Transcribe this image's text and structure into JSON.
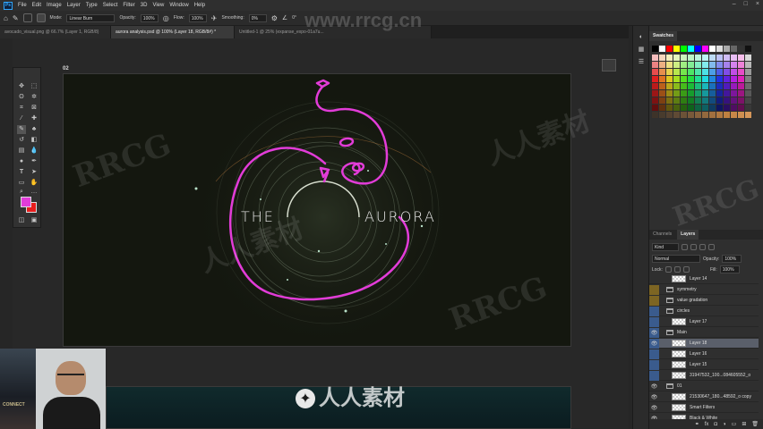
{
  "menu": {
    "app_logo": "Ps",
    "items": [
      "File",
      "Edit",
      "Image",
      "Layer",
      "Type",
      "Select",
      "Filter",
      "3D",
      "View",
      "Window",
      "Help"
    ]
  },
  "options_bar": {
    "mode_label": "Mode:",
    "mode_value": "Linear Burn",
    "opacity_label": "Opacity:",
    "opacity_value": "100%",
    "flow_label": "Flow:",
    "flow_value": "100%",
    "smoothing_label": "Smoothing:",
    "smoothing_value": "0%",
    "angle_value": "0°"
  },
  "tabs": [
    {
      "label": "avocado_visual.png @ 66.7% (Layer 1, RGB/8)",
      "active": false
    },
    {
      "label": "aurora analysis.psd @ 100% (Layer 18, RGB/8#) *",
      "active": true
    },
    {
      "label": "Untitled-1 @ 25% (expanse_expo-01a7u...",
      "active": false
    }
  ],
  "canvas": {
    "artboard_label": "02",
    "title_left": "THE",
    "title_right": "AURORA"
  },
  "webcam": {
    "poster_text": "CONNECT"
  },
  "panels": {
    "swatches_tab": "Swatches",
    "channels_tab": "Channels",
    "layers_tab": "Layers",
    "filter_kind": "Kind",
    "blend_mode": "Normal",
    "opacity_label": "Opacity:",
    "opacity_value": "100%",
    "lock_label": "Lock:",
    "fill_label": "Fill:",
    "fill_value": "100%"
  },
  "layers": [
    {
      "name": "Layer 14",
      "kind": "layer",
      "eye": "",
      "selected": false
    },
    {
      "name": "symmetry",
      "kind": "folder",
      "eye": "yellow",
      "selected": false
    },
    {
      "name": "value gradation",
      "kind": "folder",
      "eye": "yellow",
      "selected": false
    },
    {
      "name": "circles",
      "kind": "folder",
      "eye": "blue",
      "selected": false
    },
    {
      "name": "Layer 17",
      "kind": "layer",
      "eye": "blue",
      "selected": false
    },
    {
      "name": "Main",
      "kind": "folder",
      "eye": "blue-visible",
      "selected": false
    },
    {
      "name": "Layer 18",
      "kind": "layer",
      "eye": "blue-visible",
      "selected": true
    },
    {
      "name": "Layer 16",
      "kind": "layer",
      "eye": "blue",
      "selected": false
    },
    {
      "name": "Layer 15",
      "kind": "layer",
      "eye": "blue",
      "selected": false
    },
    {
      "name": "31947532_100...084605552_o",
      "kind": "layer",
      "eye": "blue",
      "selected": false
    },
    {
      "name": "01",
      "kind": "artboard",
      "eye": "visible",
      "selected": false
    },
    {
      "name": "21530647_180...48592_o copy",
      "kind": "layer",
      "eye": "visible",
      "selected": false
    },
    {
      "name": "Smart Filters",
      "kind": "filter",
      "eye": "visible",
      "selected": false
    },
    {
      "name": "Black & White",
      "kind": "filter",
      "eye": "visible",
      "selected": false
    }
  ],
  "watermarks": {
    "top": "www.rrcg.cn",
    "rrcg": "RRCG",
    "cn": "人人素材",
    "bottom": "人人素材"
  },
  "colors": {
    "foreground": "#e23cd8",
    "background": "#e81e1e",
    "scribble": "#e23cd8"
  }
}
